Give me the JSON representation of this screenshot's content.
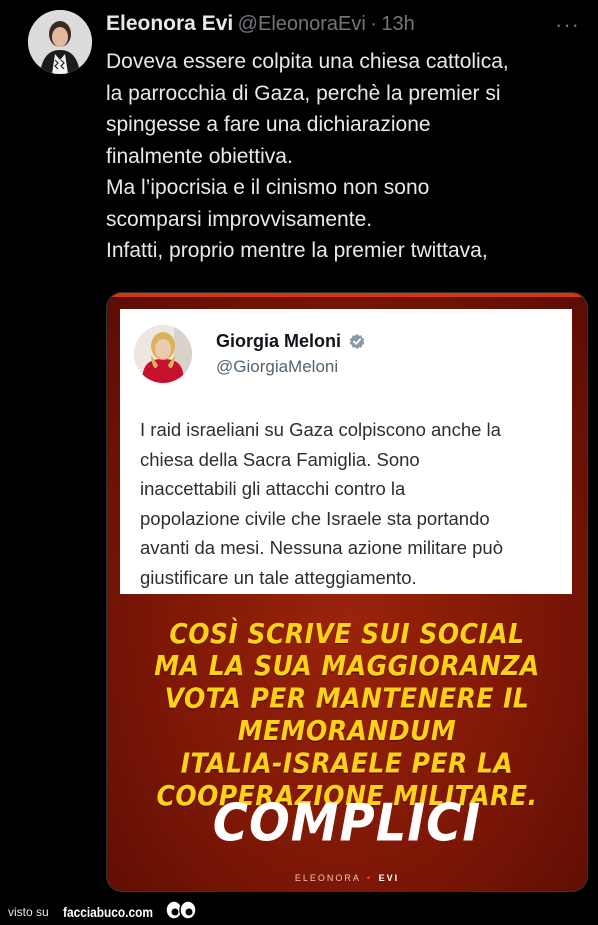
{
  "tweet": {
    "author_name": "Eleonora Evi",
    "author_handle": "@EleonoraEvi",
    "separator": "·",
    "time": "13h",
    "more_label": "···",
    "text": "Doveva essere colpita una chiesa cattolica,\nla parrocchia di Gaza, perchè la premier si\nspingesse a fare una dichiarazione\nfinalmente obiettiva.\nMa l’ipocrisia e il cinismo non sono\nscomparsi improvvisamente.\nInfatti, proprio mentre la premier twittava,"
  },
  "quoted_tweet": {
    "name": "Giorgia Meloni",
    "handle": "@GiorgiaMeloni",
    "text": "I raid israeliani su Gaza colpiscono anche la\nchiesa della Sacra Famiglia. Sono\ninaccettabili gli attacchi contro la\npopolazione civile che Israele sta portando\navanti da mesi. Nessuna azione militare può\ngiustificare un tale atteggiamento."
  },
  "media": {
    "headline": "COSÌ SCRIVE SUI SOCIAL\nMA LA SUA MAGGIORANZA\nVOTA PER MANTENERE IL\nMEMORANDUM\nITALIA-ISRAELE PER LA\nCOOPERAZIONE MILITARE.",
    "highlight": "COMPLICI",
    "watermark_first": "ELEONORA",
    "watermark_sep": "•",
    "watermark_last": "EVI"
  },
  "footer": {
    "visto_su": "visto su",
    "brand": "facciabuco.com"
  },
  "icons": {
    "more": "more-icon",
    "verified": "verified-badge-icon",
    "eyes": "eyes-icon"
  },
  "colors": {
    "background": "#000000",
    "text_primary": "#e7e9ea",
    "text_secondary": "#71767b",
    "media_red": "#7d1706",
    "headline_yellow": "#ffd21a",
    "verified_blue": "#1d9bf0"
  }
}
